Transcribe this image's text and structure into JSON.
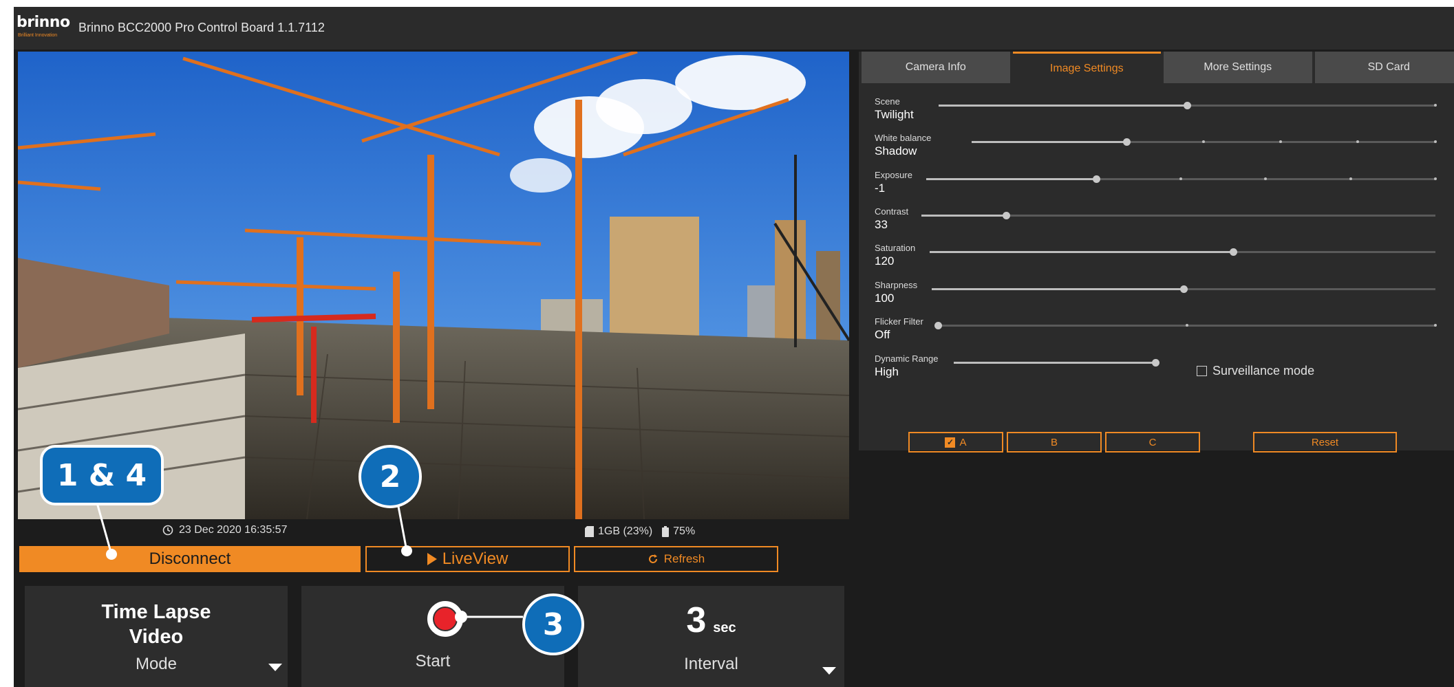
{
  "app": {
    "logo_text": "brinno",
    "logo_tagline": "Brilliant Innovation",
    "title": "Brinno BCC2000 Pro Control Board 1.1.7112"
  },
  "status": {
    "datetime": "23 Dec 2020 16:35:57",
    "storage": "1GB (23%)",
    "battery": "75%",
    "icons": [
      "clock-icon",
      "sd-card-icon",
      "battery-icon"
    ]
  },
  "actions": {
    "disconnect": "Disconnect",
    "liveview": "LiveView",
    "refresh": "Refresh"
  },
  "mode_card": {
    "title_line1": "Time Lapse",
    "title_line2": "Video",
    "label": "Mode"
  },
  "start_card": {
    "label": "Start"
  },
  "interval_card": {
    "value": "3",
    "unit": "sec",
    "label": "Interval"
  },
  "callouts": {
    "first": "1 & 4",
    "second": "2",
    "third": "3"
  },
  "settings": {
    "tabs": [
      "Camera Info",
      "Image Settings",
      "More Settings",
      "SD Card"
    ],
    "active_tab": "Image Settings",
    "sliders": [
      {
        "label": "Scene",
        "value": "Twilight",
        "level": 0.5
      },
      {
        "label": "White balance",
        "value": "Shadow",
        "level": 0.33
      },
      {
        "label": "Exposure",
        "value": "-1",
        "level": 0.33
      },
      {
        "label": "Contrast",
        "value": "33",
        "level": 0.16
      },
      {
        "label": "Saturation",
        "value": "120",
        "level": 0.6
      },
      {
        "label": "Sharpness",
        "value": "100",
        "level": 0.5
      },
      {
        "label": "Flicker Filter",
        "value": "Off",
        "level": 0.0
      },
      {
        "label": "Dynamic Range",
        "value": "High",
        "level": 1.0
      }
    ],
    "surveillance_label": "Surveillance mode",
    "presets": [
      "A",
      "B",
      "C"
    ],
    "reset_label": "Reset"
  },
  "colors": {
    "accent": "#f08a24",
    "callout": "#0f6db8",
    "background": "#1c1c1c",
    "record": "#e8232a"
  }
}
